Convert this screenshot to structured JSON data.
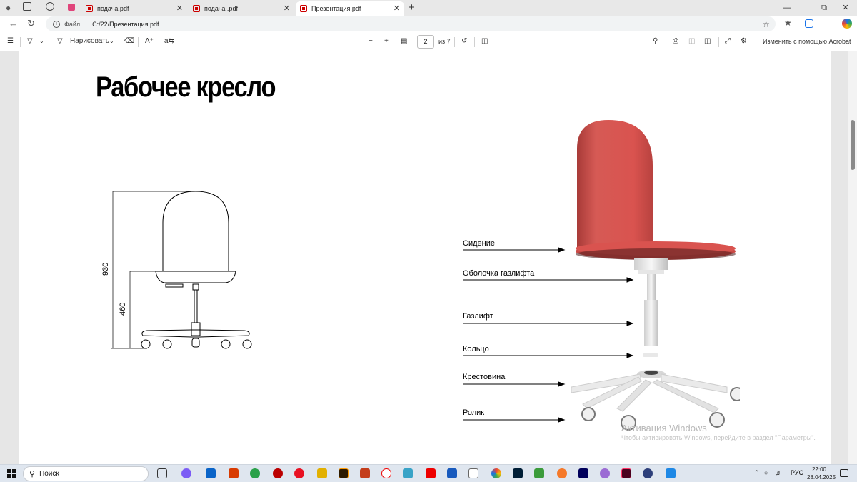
{
  "browser": {
    "tabs": [
      {
        "title": "подача.pdf",
        "active": false
      },
      {
        "title": "подача .pdf",
        "active": false
      },
      {
        "title": "Презентация.pdf",
        "active": true
      }
    ],
    "new_tab_icon": "plus-icon",
    "address": {
      "scheme_label": "Файл",
      "url": "C:/22/Презентация.pdf"
    }
  },
  "pdf_toolbar": {
    "draw_label": "Нарисовать",
    "current_page": "2",
    "page_count": "из 7",
    "edit_with_acrobat": "Изменить с помощью Acrobat"
  },
  "slide": {
    "title": "Рабочее кресло",
    "dimensions": {
      "overall_height": "930",
      "seat_height": "460"
    },
    "parts": [
      {
        "label": "Сидение"
      },
      {
        "label": "Оболочка газлифта"
      },
      {
        "label": "Газлифт"
      },
      {
        "label": "Кольцо"
      },
      {
        "label": "Крестовина"
      },
      {
        "label": "Ролик"
      }
    ]
  },
  "watermark": {
    "title": "Активация Windows",
    "subtitle": "Чтобы активировать Windows, перейдите в раздел \"Параметры\"."
  },
  "taskbar": {
    "search_placeholder": "Поиск",
    "language": "РУС",
    "time": "22:00",
    "date": "28.04.2025"
  },
  "colors": {
    "seat_red": "#d9534f",
    "accent_blue": "#0a64c8"
  }
}
